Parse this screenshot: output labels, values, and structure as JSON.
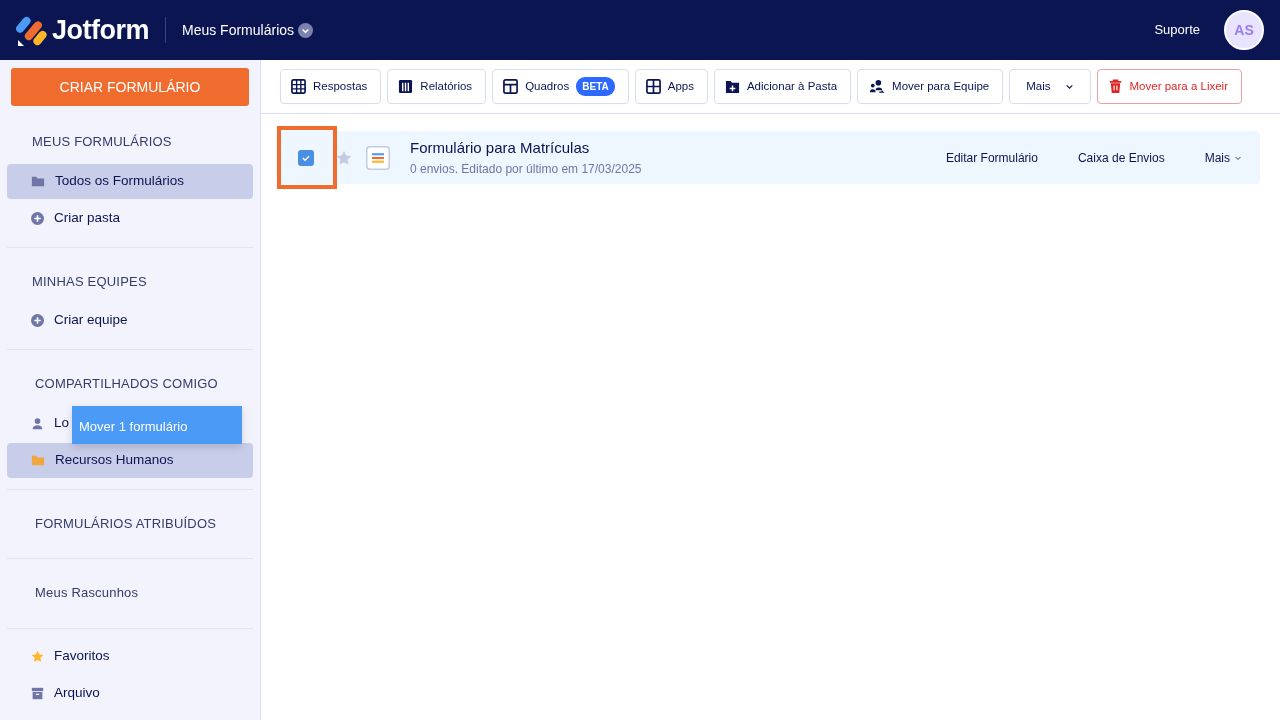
{
  "header": {
    "logo": "Jotform",
    "section": "Meus Formulários",
    "support": "Suporte",
    "avatar": "AS"
  },
  "sidebar": {
    "create_button": "CRIAR FORMULÁRIO",
    "groups": [
      {
        "heading": "MEUS FORMULÁRIOS",
        "items": [
          {
            "label": "Todos os Formulários",
            "kind": "folder",
            "selected": true
          },
          {
            "label": "Criar pasta",
            "kind": "add",
            "selected": false
          }
        ]
      },
      {
        "heading": "MINHAS EQUIPES",
        "items": [
          {
            "label": "Criar equipe",
            "kind": "add",
            "selected": false
          }
        ]
      },
      {
        "heading": "COMPARTILHADOS COMIGO",
        "items": [
          {
            "label": "Lo",
            "kind": "person",
            "selected": false
          },
          {
            "label": "Recursos Humanos",
            "kind": "shared-folder",
            "selected": true
          }
        ]
      },
      {
        "heading": "FORMULÁRIOS ATRIBUÍDOS"
      },
      {
        "heading": "Meus Rascunhos"
      },
      {
        "items": [
          {
            "label": "Favoritos",
            "kind": "star",
            "selected": false
          },
          {
            "label": "Arquivo",
            "kind": "archive",
            "selected": false
          }
        ]
      }
    ]
  },
  "drag_tooltip": "Mover 1 formulário",
  "toolbar": [
    {
      "label": "Respostas",
      "kind": "table"
    },
    {
      "label": "Relatórios",
      "kind": "report"
    },
    {
      "label": "Quadros",
      "kind": "board",
      "badge": "BETA"
    },
    {
      "label": "Apps",
      "kind": "apps"
    },
    {
      "label": "Adicionar à Pasta",
      "kind": "folder-add"
    },
    {
      "label": "Mover para Equipe",
      "kind": "team"
    },
    {
      "label": "Mais",
      "kind": "more"
    },
    {
      "label": "Mover para a Lixeir",
      "kind": "trash"
    }
  ],
  "forms": [
    {
      "title": "Formulário para Matrículas",
      "subtitle": "0 envios. Editado por último em 17/03/2025",
      "checked": true,
      "starred": false,
      "actions": [
        "Editar Formulário",
        "Caixa de Envios",
        "Mais"
      ]
    }
  ]
}
